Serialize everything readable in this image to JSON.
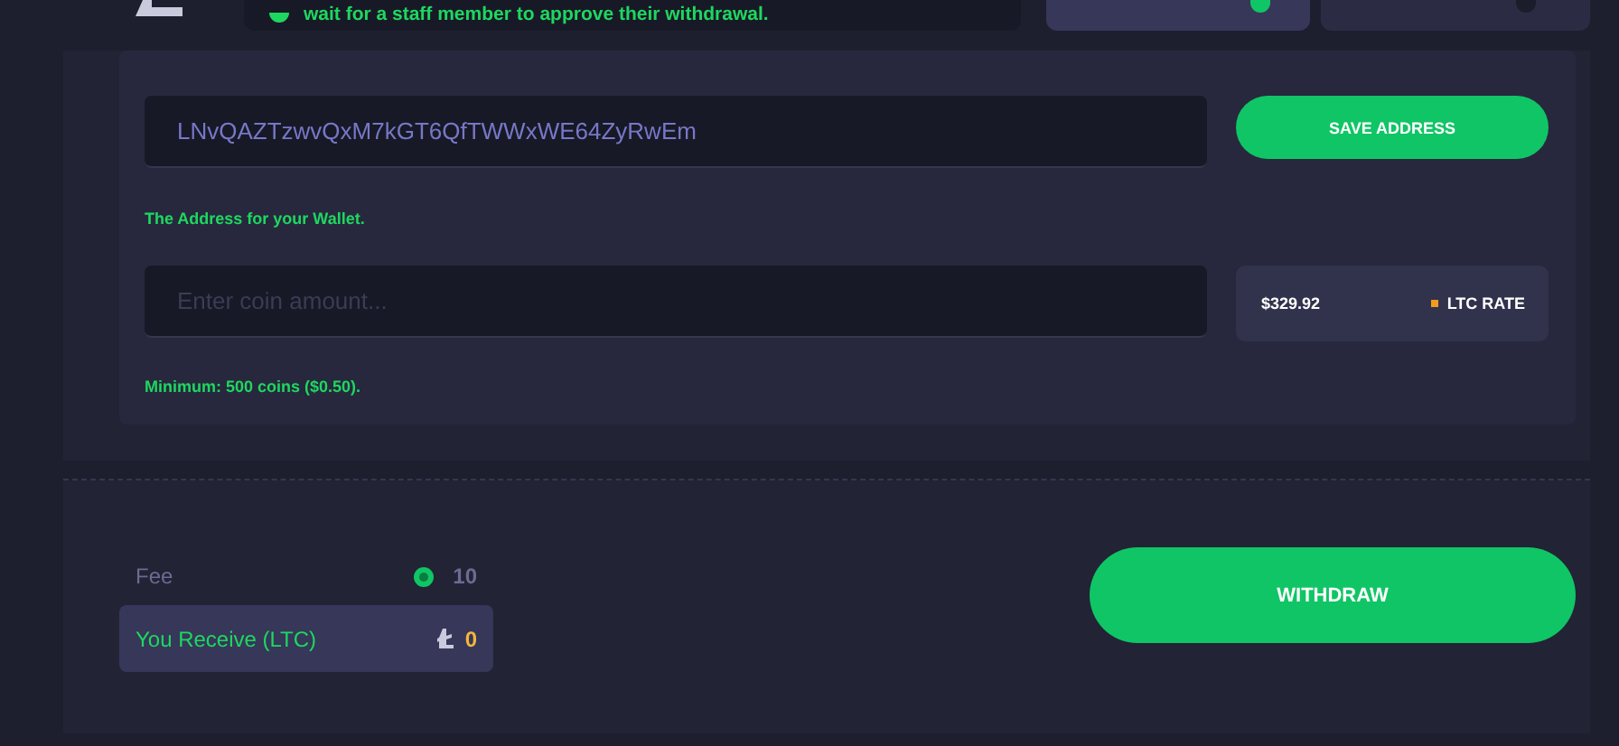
{
  "notice": {
    "text": "wait for a staff member to approve their withdrawal."
  },
  "address_options": [
    {
      "selected": true
    },
    {
      "selected": false
    }
  ],
  "address": {
    "value": "LNvQAZTzwvQxM7kGT6QfTWWxWE64ZyRwEm",
    "hint": "The Address for your Wallet.",
    "save_button": "SAVE ADDRESS"
  },
  "amount": {
    "placeholder": "Enter coin amount...",
    "hint": "Minimum: 500 coins ($0.50).",
    "rate_value": "$329.92",
    "rate_label": "LTC RATE"
  },
  "summary": {
    "fee_label": "Fee",
    "fee_value": "10",
    "receive_label": "You Receive (LTC)",
    "receive_value": "0"
  },
  "withdraw_button": "WITHDRAW"
}
